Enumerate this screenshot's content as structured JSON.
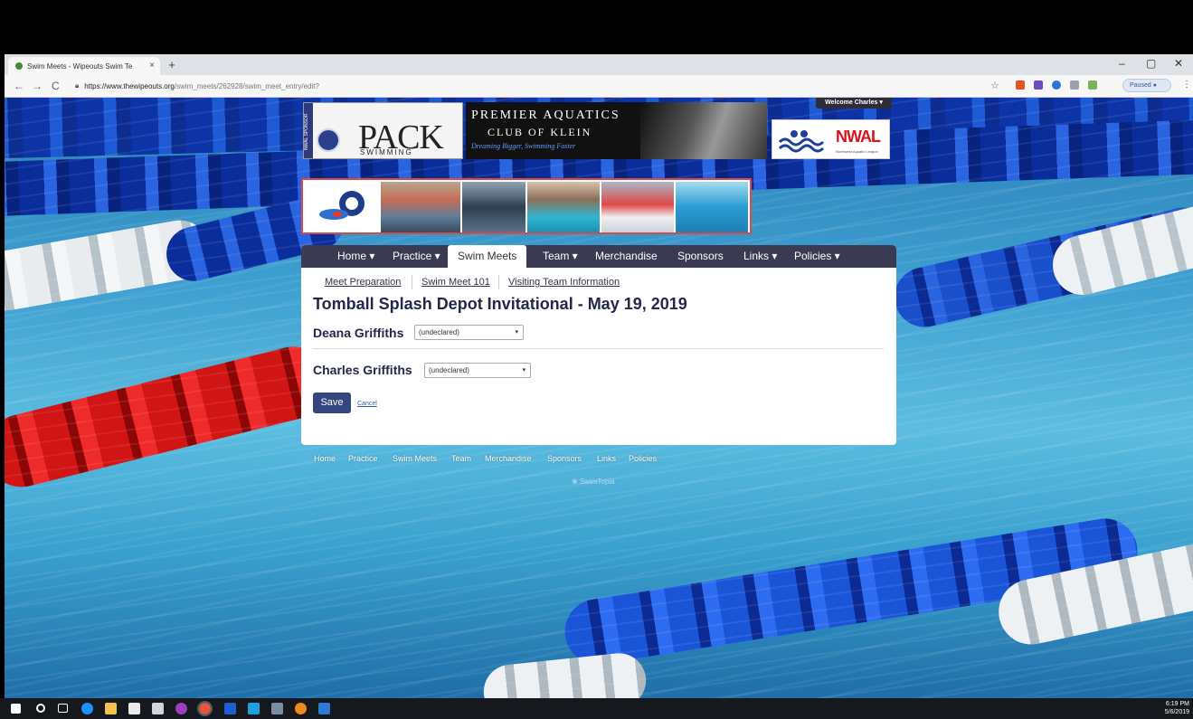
{
  "browser": {
    "tab_title": "Swim Meets - Wipeouts Swim Te",
    "tab_close": "×",
    "new_tab": "+",
    "window_controls": {
      "minimize": "–",
      "maximize": "▢",
      "close": "✕"
    },
    "nav": {
      "back": "←",
      "forward": "→",
      "reload": "C"
    },
    "url_host": "https://www.thewipeouts.org",
    "url_path": "/swim_meets/262928/swim_meet_entry/edit?",
    "star": "☆",
    "paused_label": "Paused",
    "menu": "⋮"
  },
  "welcome": "Welcome Charles ▾",
  "sponsors": {
    "pack_side": "NWAL SPONSOR",
    "pack_title": "PACK",
    "pack_sub": "SWIMMING",
    "premier_line1": "PREMIER AQUATICS",
    "premier_line2": "CLUB OF KLEIN",
    "premier_line3": "Dreaming Bigger, Swimming Faster",
    "nwal_text": "NWAL",
    "nwal_sub": "Northwest Aquatic League"
  },
  "nav": {
    "items": [
      {
        "label": "Home ▾"
      },
      {
        "label": "Practice ▾"
      },
      {
        "label": "Swim Meets"
      },
      {
        "label": "Team ▾"
      },
      {
        "label": "Merchandise"
      },
      {
        "label": "Sponsors"
      },
      {
        "label": "Links ▾"
      },
      {
        "label": "Policies ▾"
      }
    ]
  },
  "subnav": {
    "items": [
      {
        "label": "Meet Preparation"
      },
      {
        "label": "Swim Meet 101"
      },
      {
        "label": "Visiting Team Information"
      }
    ]
  },
  "event_title": "Tomball Splash Depot Invitational - May 19, 2019",
  "swimmers": [
    {
      "name": "Deana Griffiths",
      "selection": "(undeclared)"
    },
    {
      "name": "Charles Griffiths",
      "selection": "(undeclared)"
    }
  ],
  "form": {
    "save_label": "Save",
    "cancel_label": "Cancel"
  },
  "footer": {
    "links": [
      "Home",
      "Practice",
      "Swim Meets",
      "Team",
      "Merchandise",
      "Sponsors",
      "Links",
      "Policies"
    ],
    "powered": "SwimTopia"
  },
  "taskbar": {
    "time": "6:19 PM",
    "date": "5/6/2019"
  },
  "colors": {
    "navbar": "#3b3a53",
    "title": "#23274a",
    "save_button": "#344680",
    "nwal_red": "#d8141a"
  }
}
